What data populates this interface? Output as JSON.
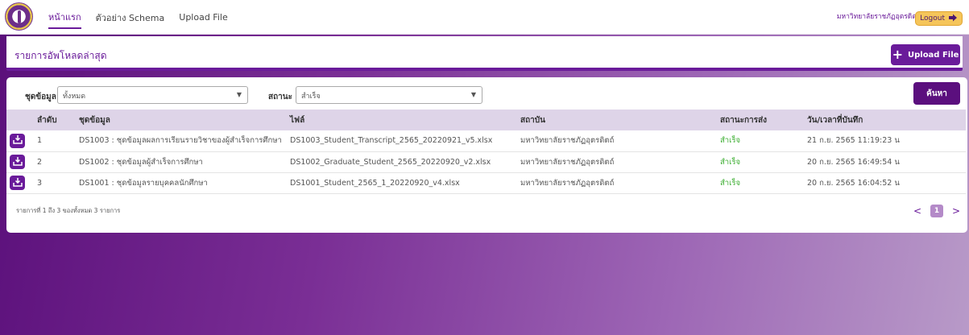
{
  "nav": {
    "items": [
      "หน้าแรก",
      "ตัวอย่าง Schema",
      "Upload File"
    ],
    "active_index": 0
  },
  "user": {
    "university": "มหาวิทยาลัยราชภัฏอุตรดิตถ์",
    "logout_label": "Logout"
  },
  "header": {
    "title": "รายการอัพโหลดล่าสุด",
    "upload_label": "Upload File"
  },
  "filters": {
    "dataset_label": "ชุดข้อมูล",
    "dataset_value": "ทั้งหมด",
    "status_label": "สถานะ",
    "status_value": "สำเร็จ",
    "search_label": "ค้นหา"
  },
  "table": {
    "columns": [
      "",
      "ลำดับ",
      "ชุดข้อมูล",
      "ไฟล์",
      "สถาบัน",
      "สถานะการส่ง",
      "วัน/เวลาที่บันทึก"
    ],
    "rows": [
      {
        "no": "1",
        "dataset": "DS1003 : ชุดข้อมูลผลการเรียนรายวิชาของผู้สำเร็จการศึกษา",
        "file": "DS1003_Student_Transcript_2565_20220921_v5.xlsx",
        "institution": "มหาวิทยาลัยราชภัฏอุตรดิตถ์",
        "status": "สำเร็จ",
        "datetime": "21 ก.ย. 2565 11:19:23 น"
      },
      {
        "no": "2",
        "dataset": "DS1002 : ชุดข้อมูลผู้สำเร็จการศึกษา",
        "file": "DS1002_Graduate_Student_2565_20220920_v2.xlsx",
        "institution": "มหาวิทยาลัยราชภัฏอุตรดิตถ์",
        "status": "สำเร็จ",
        "datetime": "20 ก.ย. 2565 16:49:54 น"
      },
      {
        "no": "3",
        "dataset": "DS1001 : ชุดข้อมูลรายบุคคลนักศึกษา",
        "file": "DS1001_Student_2565_1_20220920_v4.xlsx",
        "institution": "มหาวิทยาลัยราชภัฏอุตรดิตถ์",
        "status": "สำเร็จ",
        "datetime": "20 ก.ย. 2565 16:04:52 น"
      }
    ]
  },
  "pagination": {
    "info": "รายการที่ 1 ถึง 3 ของทั้งหมด 3 รายการ",
    "prev": "<",
    "current": "1",
    "next": ">"
  },
  "colors": {
    "primary": "#6a1b9a",
    "accent": "#f5c55a",
    "success": "#3aad2f",
    "header_row": "#ded4e8"
  },
  "icons": [
    "logo-seal",
    "plus-icon",
    "download-icon",
    "logout-icon",
    "chevron-down-icon"
  ]
}
